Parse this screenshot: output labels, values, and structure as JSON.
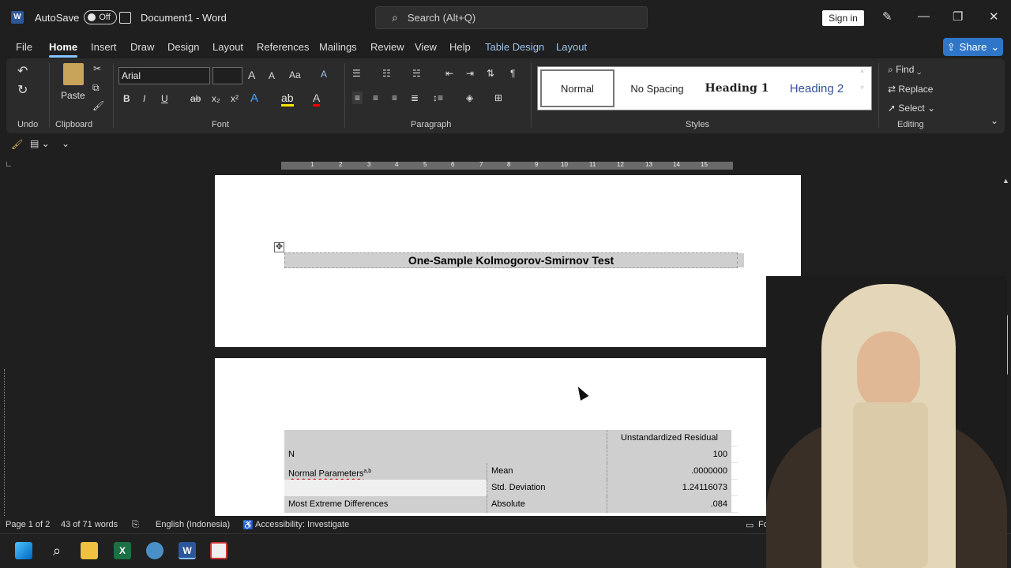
{
  "titlebar": {
    "autosave_label": "AutoSave",
    "autosave_state": "Off",
    "doc_title": "Document1 - Word",
    "search_placeholder": "Search (Alt+Q)",
    "signin_label": "Sign in"
  },
  "menu": {
    "tabs": [
      "File",
      "Home",
      "Insert",
      "Draw",
      "Design",
      "Layout",
      "References",
      "Mailings",
      "Review",
      "View",
      "Help",
      "Table Design",
      "Layout"
    ],
    "active": "Home",
    "share_label": "Share"
  },
  "ribbon": {
    "undo_label": "Undo",
    "clipboard_label": "Clipboard",
    "paste_label": "Paste",
    "font_label": "Font",
    "font_name": "Arial",
    "font_size": "",
    "paragraph_label": "Paragraph",
    "styles_label": "Styles",
    "editing_label": "Editing",
    "styles": [
      "Normal",
      "No Spacing",
      "Heading 1",
      "Heading 2"
    ],
    "find_label": "Find",
    "replace_label": "Replace",
    "select_label": "Select"
  },
  "ruler": {
    "numbers": [
      "1",
      "2",
      "3",
      "4",
      "5",
      "6",
      "7",
      "8",
      "9",
      "10",
      "11",
      "12",
      "13",
      "14",
      "15"
    ]
  },
  "document": {
    "table_title": "One-Sample Kolmogorov-Smirnov Test",
    "header_col": "Unstandardized Residual",
    "rows": [
      {
        "c1": "N",
        "c2": "",
        "c3": "100"
      },
      {
        "c1": "Normal Parameters",
        "sup": "a,b",
        "c2": "Mean",
        "c3": ".0000000"
      },
      {
        "c1": "",
        "c2": "Std. Deviation",
        "c3": "1.24116073"
      },
      {
        "c1": "Most Extreme Differences",
        "c2": "Absolute",
        "c3": ".084"
      }
    ]
  },
  "status": {
    "page": "Page 1 of 2",
    "words": "43 of 71 words",
    "language": "English (Indonesia)",
    "accessibility": "Accessibility: Investigate",
    "focus": "Fo"
  },
  "colors": {
    "accent": "#2f76c9",
    "table_fill": "#cfcfcf"
  }
}
